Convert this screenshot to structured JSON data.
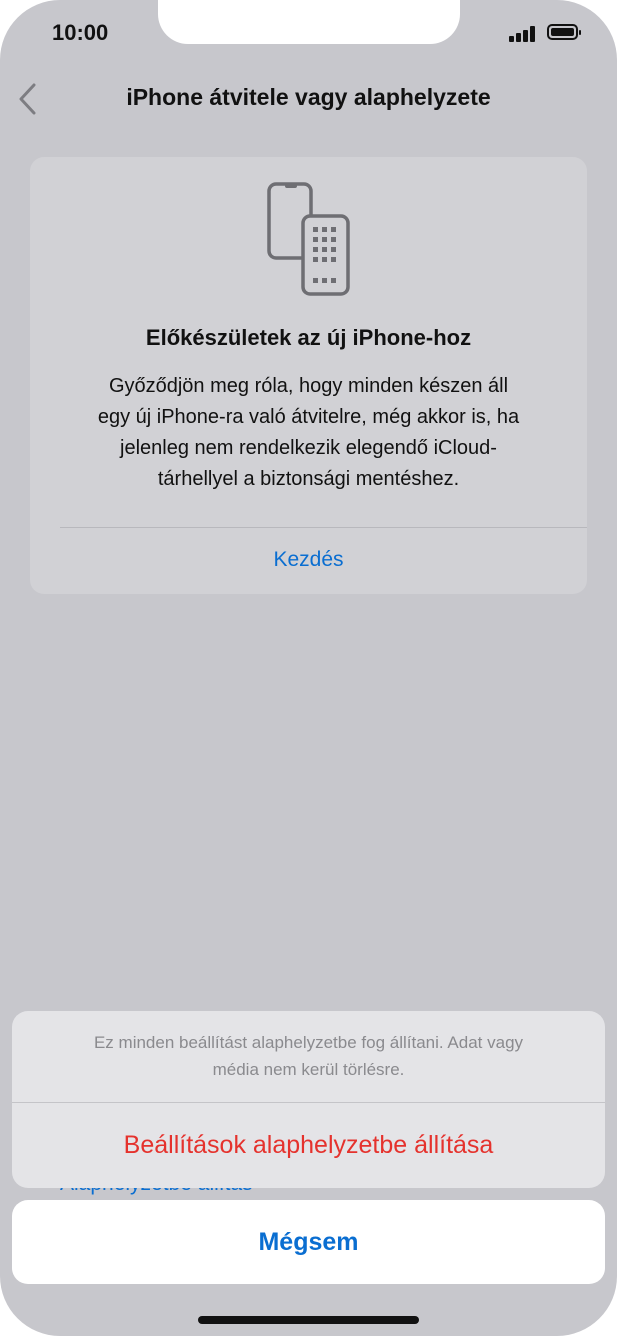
{
  "status_bar": {
    "time": "10:00",
    "icons": [
      "signal-icon",
      "battery-icon"
    ]
  },
  "nav": {
    "back_icon": "chevron-left-icon",
    "title": "iPhone átvitele vagy alaphelyzete"
  },
  "card": {
    "icon": "transfer-phones-icon",
    "title": "Előkészületek az új iPhone-hoz",
    "lines": [
      "Győződjön meg róla, hogy minden készen áll",
      "egy új iPhone-ra való átvitelre, még akkor is, ha",
      "jelenleg nem rendelkezik elegendő iCloud-",
      "tárhellyel a biztonsági mentéshez."
    ],
    "link": "Kezdés"
  },
  "behind_item": "Alaphelyzetbe állítás",
  "action_sheet": {
    "message_lines": [
      "Ez minden beállítást alaphelyzetbe fog állítani. Adat vagy",
      "média nem kerül törlésre."
    ],
    "destructive_action": "Beállítások alaphelyzetbe állítása",
    "cancel": "Mégsem"
  },
  "colors": {
    "accent": "#0a6ed1",
    "destructive": "#e5322d",
    "dim_background": "#c7c7cc"
  }
}
